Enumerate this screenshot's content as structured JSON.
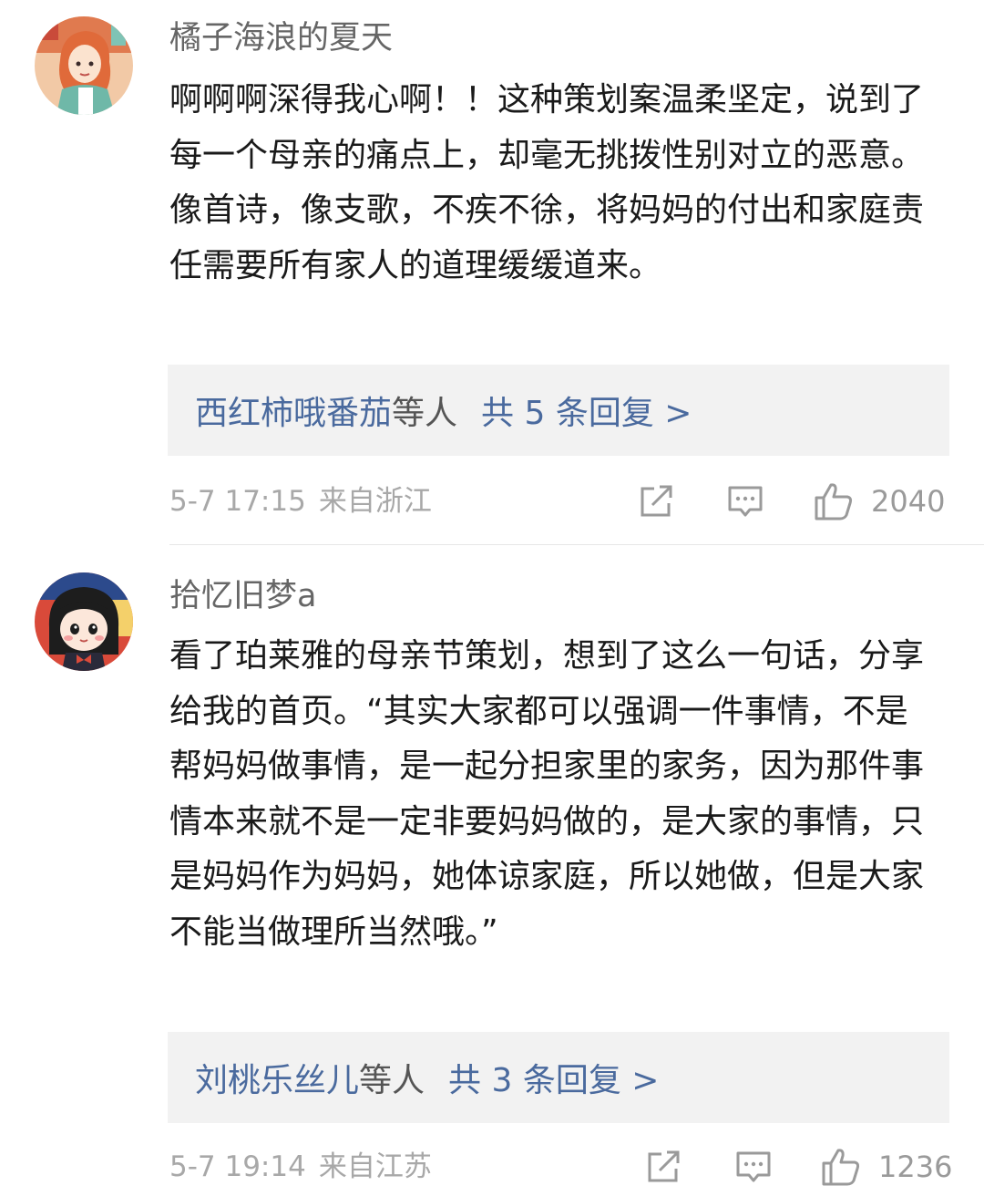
{
  "comments": [
    {
      "username": "橘子海浪的夏天",
      "avatar_icon": "avatar-girl-orange-hair",
      "content": "啊啊啊深得我心啊！！这种策划案温柔坚定，说到了每一个母亲的痛点上，却毫无挑拨性别对立的恶意。像首诗，像支歌，不疾不徐，将妈妈的付出和家庭责任需要所有家人的道理缓缓道来。",
      "replies": {
        "names": "西红柿哦番茄",
        "suffix": "等人",
        "count": "共 5 条回复 >"
      },
      "time": "5-7 17:15",
      "location": "来自浙江",
      "likes": "2040"
    },
    {
      "username": "拾忆旧梦a",
      "avatar_icon": "avatar-girl-black-hair",
      "content": "看了珀莱雅的母亲节策划，想到了这么一句话，分享给我的首页。“其实大家都可以强调一件事情，不是帮妈妈做事情，是一起分担家里的家务，因为那件事情本来就不是一定非要妈妈做的，是大家的事情，只是妈妈作为妈妈，她体谅家庭，所以她做，但是大家不能当做理所当然哦。”",
      "replies": {
        "names": "刘桃乐丝儿",
        "suffix": "等人",
        "count": "共 3 条回复 >"
      },
      "time": "5-7 19:14",
      "location": "来自江苏",
      "likes": "1236"
    }
  ],
  "icons": {
    "share": "share-icon",
    "reply": "comment-icon",
    "like": "thumbs-up-icon"
  },
  "colors": {
    "link": "#4a6a9e",
    "meta": "#a8a8a8",
    "reply_box_bg": "#f2f2f2"
  }
}
